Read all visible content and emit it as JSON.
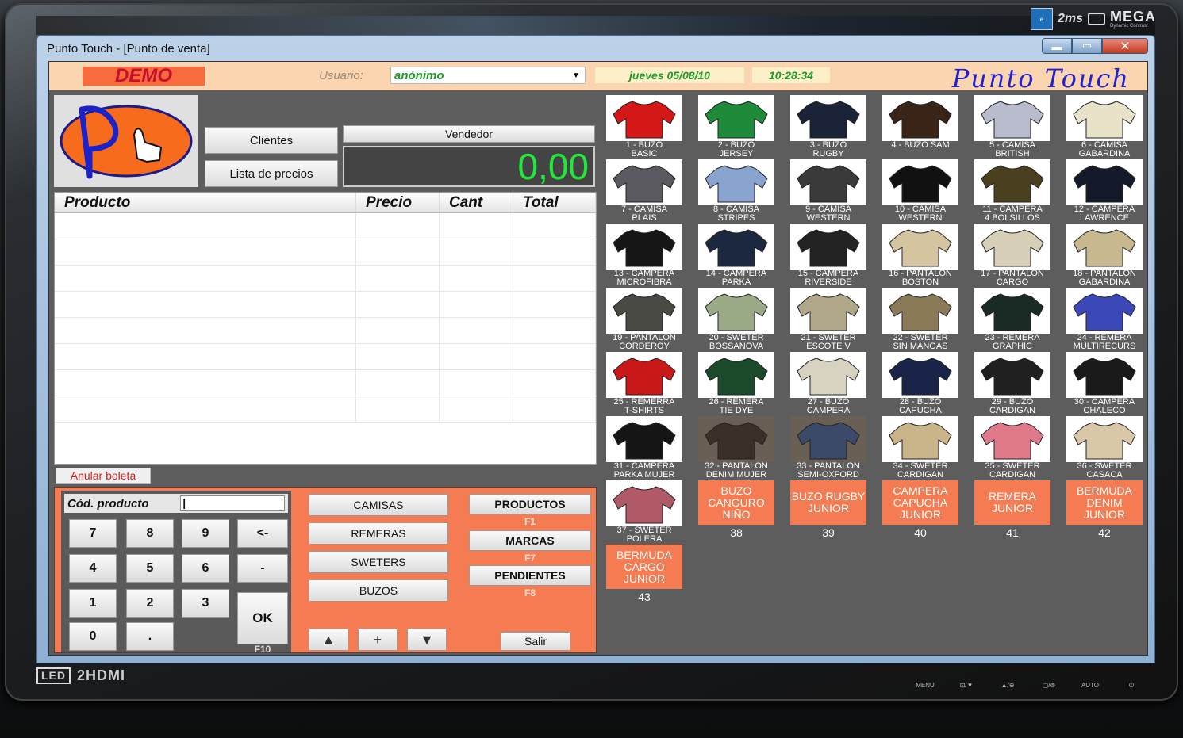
{
  "window": {
    "title": "Punto Touch - [Punto de venta]",
    "minimize": "▬",
    "maximize": "▭",
    "close": "✕"
  },
  "monitor": {
    "brand_ms": "2ms",
    "mega": "MEGA",
    "mega_sub": "Dynamic Contrast",
    "led": "LED",
    "hdmi": "2HDMI",
    "buttons": [
      "MENU",
      "⊡/▼",
      "▲/⊕",
      "▢/⊚",
      "AUTO",
      "⏻"
    ]
  },
  "header": {
    "demo": "DEMO",
    "user_label": "Usuario:",
    "user_value": "anónimo",
    "date": "jueves 05/08/10",
    "time": "10:28:34",
    "brand": "Punto Touch"
  },
  "buttons": {
    "clientes": "Clientes",
    "lista_precios": "Lista de precios",
    "vendedor": "Vendedor",
    "anular": "Anular boleta",
    "salir": "Salir"
  },
  "total": "0,00",
  "table": {
    "columns": [
      "Producto",
      "Precio",
      "Cant",
      "Total"
    ],
    "rows": 8
  },
  "keypad": {
    "code_label": "Cód. producto",
    "keys": [
      "7",
      "8",
      "9",
      "<-",
      "4",
      "5",
      "6",
      "-",
      "1",
      "2",
      "3",
      "0",
      "."
    ],
    "ok": "OK",
    "ok_fkey": "F10"
  },
  "categories": [
    "CAMISAS",
    "REMERAS",
    "SWETERS",
    "BUZOS"
  ],
  "nav": [
    {
      "label": "PRODUCTOS",
      "fkey": "F1"
    },
    {
      "label": "MARCAS",
      "fkey": "F7"
    },
    {
      "label": "PENDIENTES",
      "fkey": "F8"
    }
  ],
  "arrows": [
    "▲",
    "+",
    "▼"
  ],
  "products": [
    {
      "l1": "1 - BUZO",
      "l2": "BASIC",
      "color": "#d41818"
    },
    {
      "l1": "2 - BUZO",
      "l2": "JERSEY",
      "color": "#1f8a3a"
    },
    {
      "l1": "3 - BUZO",
      "l2": "RUGBY",
      "color": "#1a2238"
    },
    {
      "l1": "4 - BUZO SAM",
      "l2": "",
      "color": "#3a2418"
    },
    {
      "l1": "5 - CAMISA",
      "l2": "BRITISH",
      "color": "#b8bccc"
    },
    {
      "l1": "6 - CAMISA",
      "l2": "GABARDINA",
      "color": "#e8e2c8"
    },
    {
      "l1": "7 - CAMISA",
      "l2": "PLAIS",
      "color": "#5a5a60"
    },
    {
      "l1": "8 - CAMISA",
      "l2": "STRIPES",
      "color": "#8aa4d0"
    },
    {
      "l1": "9 - CAMISA",
      "l2": "WESTERN",
      "color": "#3a3a3a"
    },
    {
      "l1": "10 - CAMISA",
      "l2": "WESTERN",
      "color": "#111111"
    },
    {
      "l1": "11 - CAMPERA",
      "l2": "4 BOLSILLOS",
      "color": "#4a4020"
    },
    {
      "l1": "12 - CAMPERA",
      "l2": "LAWRENCE",
      "color": "#141a2a"
    },
    {
      "l1": "13 - CAMPERA",
      "l2": "MICROFIBRA",
      "color": "#161616"
    },
    {
      "l1": "14 - CAMPERA",
      "l2": "PARKA",
      "color": "#1c2840"
    },
    {
      "l1": "15 - CAMPERA",
      "l2": "RIVERSIDE",
      "color": "#222222"
    },
    {
      "l1": "16 - PANTALON",
      "l2": "BOSTON",
      "color": "#d4c4a0"
    },
    {
      "l1": "17 - PANTALON",
      "l2": "CARGO",
      "color": "#d8cfb8"
    },
    {
      "l1": "18 - PANTALON",
      "l2": "GABARDINA",
      "color": "#c8b890"
    },
    {
      "l1": "19 - PANTALON",
      "l2": "CORDEROY",
      "color": "#4a4a44"
    },
    {
      "l1": "20 - SWETER",
      "l2": "BOSSANOVA",
      "color": "#9aaa86"
    },
    {
      "l1": "21 - SWETER",
      "l2": "ESCOTE V",
      "color": "#b0a888"
    },
    {
      "l1": "22 - SWETER",
      "l2": "SIN MANGAS",
      "color": "#8a7a58"
    },
    {
      "l1": "23 - REMERA",
      "l2": "GRAPHIC",
      "color": "#1a2a24"
    },
    {
      "l1": "24 - REMERA",
      "l2": "MULTIRECURS",
      "color": "#3a48b8"
    },
    {
      "l1": "25 - REMERRA",
      "l2": "T-SHIRTS",
      "color": "#c81818"
    },
    {
      "l1": "26 - REMERA",
      "l2": "TIE DYE",
      "color": "#1a4a2a"
    },
    {
      "l1": "27 - BUZO",
      "l2": "CAMPERA",
      "color": "#d8d2c0"
    },
    {
      "l1": "28 - BUZO",
      "l2": "CAPUCHA",
      "color": "#1a2448"
    },
    {
      "l1": "29 - BUZO",
      "l2": "CARDIGAN",
      "color": "#202020"
    },
    {
      "l1": "30 - CAMPERA",
      "l2": "CHALECO",
      "color": "#1a1a1a"
    },
    {
      "l1": "31 - CAMPERA",
      "l2": "PARKA MUJER",
      "color": "#151515"
    },
    {
      "l1": "32 - PANTALON",
      "l2": "DENIM MUJER",
      "color": "#3a3028",
      "dark": true
    },
    {
      "l1": "33 - PANTALON",
      "l2": "SEMI-OXFORD",
      "color": "#3a4a68",
      "dark": true
    },
    {
      "l1": "34 - SWETER",
      "l2": "CARDIGAN",
      "color": "#c8b488"
    },
    {
      "l1": "35 - SWETER",
      "l2": "CARDIGAN",
      "color": "#e07a8a"
    },
    {
      "l1": "36 - SWETER",
      "l2": "CASACA",
      "color": "#d8c8a8"
    },
    {
      "l1": "37 - SWETER",
      "l2": "POLERA",
      "color": "#b05a68"
    }
  ],
  "tiles": [
    {
      "label": "BUZO CANGURO NIÑO",
      "num": "38"
    },
    {
      "label": "BUZO RUGBY JUNIOR",
      "num": "39"
    },
    {
      "label": "CAMPERA CAPUCHA JUNIOR",
      "num": "40"
    },
    {
      "label": "REMERA JUNIOR",
      "num": "41"
    },
    {
      "label": "BERMUDA DENIM JUNIOR",
      "num": "42"
    },
    {
      "label": "BERMUDA CARGO JUNIOR",
      "num": "43"
    }
  ],
  "colors": {
    "accent_orange": "#f57b52",
    "header_bg": "#fbd5b0",
    "green_text": "#1e9a2c",
    "total_green": "#22e83a",
    "brand_blue": "#2222cc"
  }
}
